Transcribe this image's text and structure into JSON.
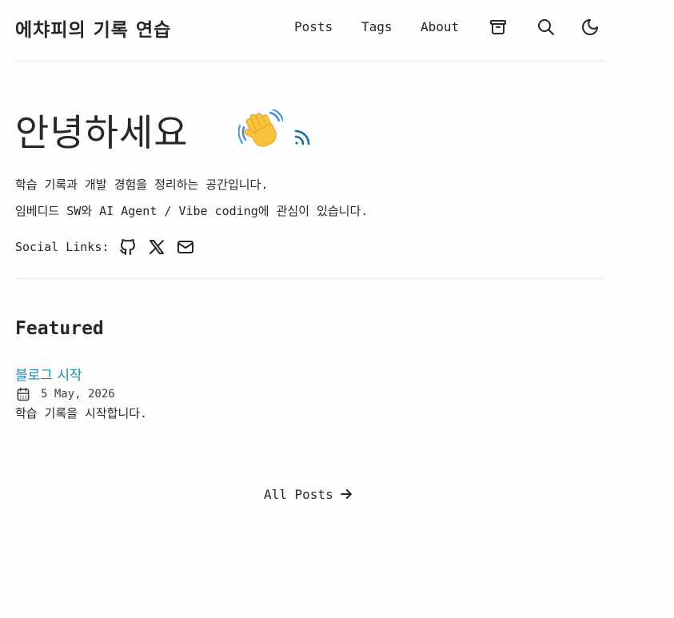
{
  "header": {
    "site_title": "에챠피의 기록 연습",
    "nav": {
      "posts": "Posts",
      "tags": "Tags",
      "about": "About"
    },
    "icons": [
      "archive-icon",
      "search-icon",
      "moon-icon"
    ]
  },
  "hero": {
    "title": "안녕하세요",
    "emoji": "waving-hand",
    "rss_icon": "rss-icon",
    "intro_line_1": "학습 기록과 개발 경험을 정리하는 공간입니다.",
    "intro_line_2": "임베디드 SW와 AI Agent / Vibe coding에 관심이 있습니다.",
    "social_label": "Social Links:",
    "social_icons": [
      "github-icon",
      "x-icon",
      "mail-icon"
    ]
  },
  "featured": {
    "heading": "Featured",
    "posts": [
      {
        "title": "블로그 시작",
        "date": "5 May, 2026",
        "description": "학습 기록을 시작합니다."
      }
    ]
  },
  "footer_link": {
    "all_posts": "All Posts"
  },
  "colors": {
    "background": "#fdfdfd",
    "text": "#282728",
    "accent": "#1a8ab1",
    "rss": "#1a6e9e",
    "divider": "#e6e6e6"
  }
}
